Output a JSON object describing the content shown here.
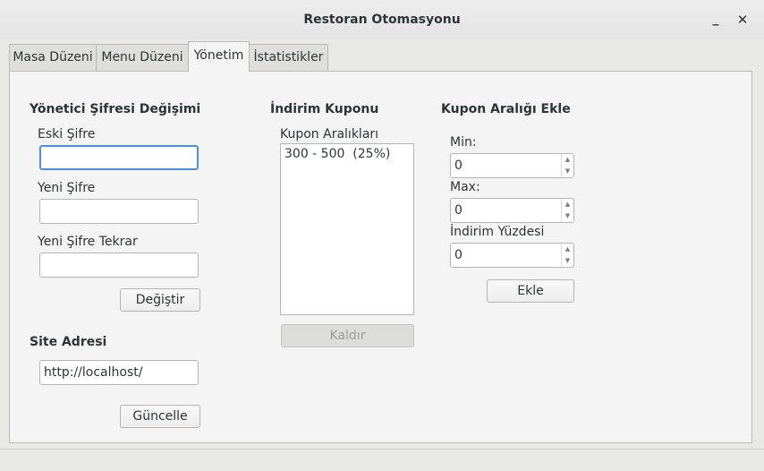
{
  "window": {
    "title": "Restoran Otomasyonu",
    "minimize": "_",
    "close": "✕"
  },
  "tabs": [
    "Masa Düzeni",
    "Menu Düzeni",
    "Yönetim",
    "İstatistikler"
  ],
  "password_section": {
    "heading": "Yönetici Şifresi Değişimi",
    "old_label": "Eski Şifre",
    "old_value": "",
    "new_label": "Yeni Şifre",
    "new_value": "",
    "repeat_label": "Yeni Şifre Tekrar",
    "repeat_value": "",
    "button": "Değiştir"
  },
  "site_section": {
    "heading": "Site Adresi",
    "value": "http://localhost/",
    "button": "Güncelle"
  },
  "coupon_section": {
    "heading": "İndirim Kuponu",
    "list_label": "Kupon Aralıkları",
    "items": [
      "300 - 500  (25%)"
    ],
    "remove_button": "Kaldır"
  },
  "add_section": {
    "heading": "Kupon Aralığı Ekle",
    "min_label": "Min:",
    "min_value": "0",
    "max_label": "Max:",
    "max_value": "0",
    "percent_label": "İndirim Yüzdesi",
    "percent_value": "0",
    "add_button": "Ekle"
  }
}
